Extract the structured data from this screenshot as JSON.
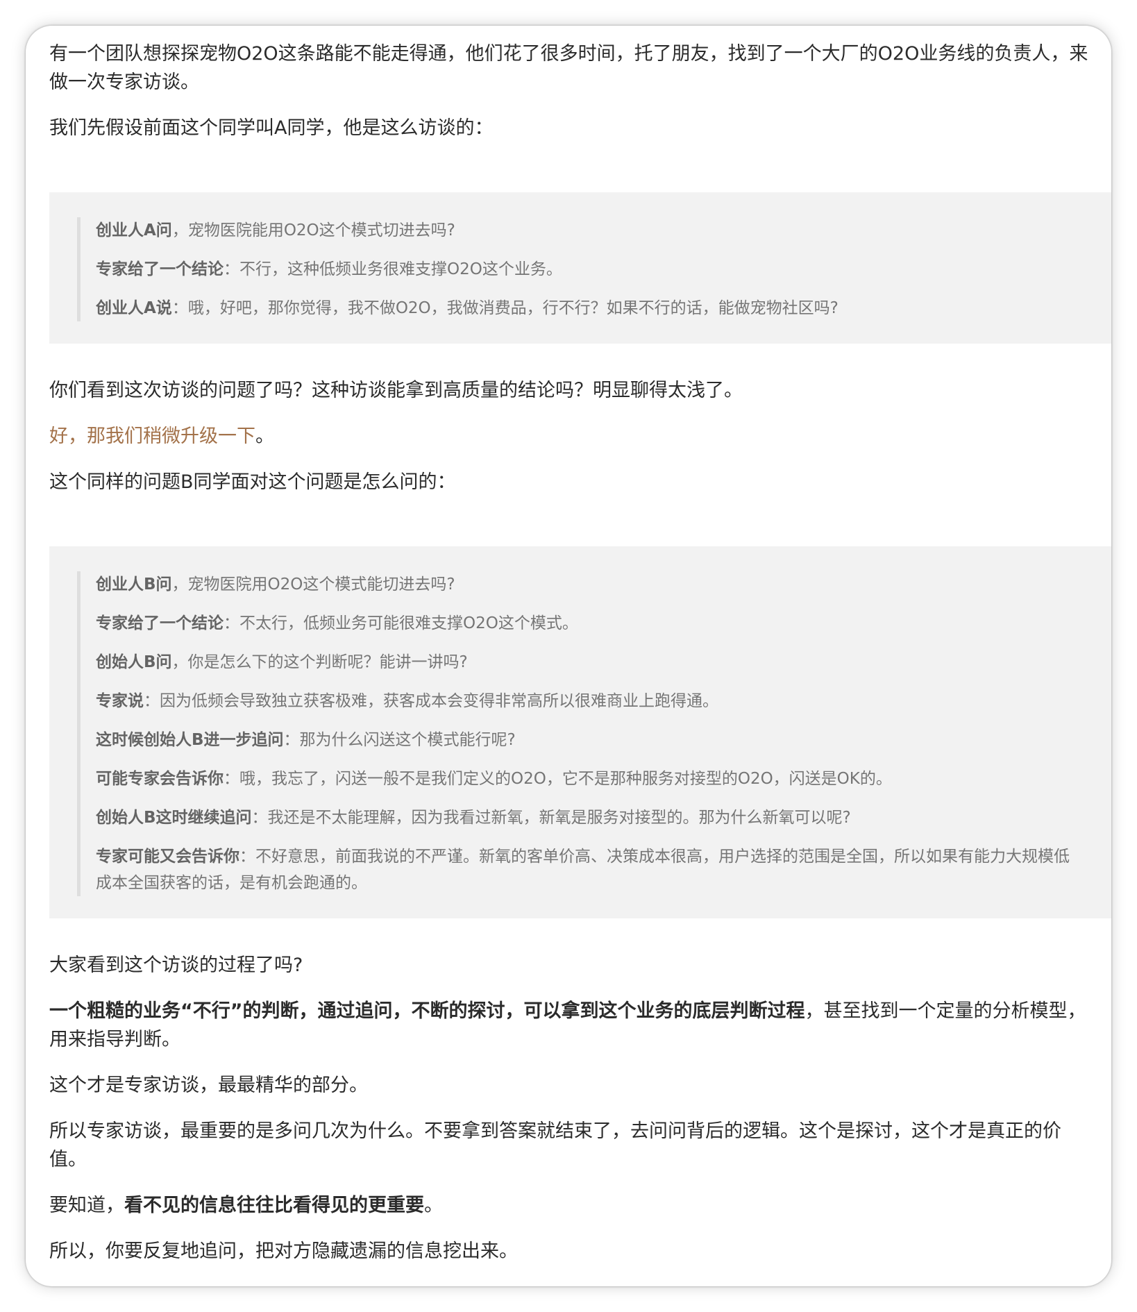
{
  "intro": {
    "p1": "有一个团队想探探宠物O2O这条路能不能走得通，他们花了很多时间，托了朋友，找到了一个大厂的O2O业务线的负责人，来做一次专家访谈。",
    "p2": "我们先假设前面这个同学叫A同学，他是这么访谈的："
  },
  "quote_a": [
    {
      "speaker": "创业人A问",
      "text": "，宠物医院能用O2O这个模式切进去吗?"
    },
    {
      "speaker": "专家给了一个结论",
      "text": "：不行，这种低频业务很难支撑O2O这个业务。"
    },
    {
      "speaker": "创业人A说",
      "text": "：哦，好吧，那你觉得，我不做O2O，我做消费品，行不行？如果不行的话，能做宠物社区吗?"
    }
  ],
  "middle": {
    "p1": "你们看到这次访谈的问题了吗？这种访谈能拿到高质量的结论吗？明显聊得太浅了。",
    "p2_accent": "好，那我们稍微升级一下",
    "p2_end": "。",
    "p3": "这个同样的问题B同学面对这个问题是怎么问的："
  },
  "quote_b": [
    {
      "speaker": "创业人B问",
      "text": "，宠物医院用O2O这个模式能切进去吗?"
    },
    {
      "speaker": "专家给了一个结论",
      "text": "：不太行，低频业务可能很难支撑O2O这个模式。"
    },
    {
      "speaker": "创始人B问",
      "text": "，你是怎么下的这个判断呢？能讲一讲吗?"
    },
    {
      "speaker": "专家说",
      "text": "：因为低频会导致独立获客极难，获客成本会变得非常高所以很难商业上跑得通。"
    },
    {
      "speaker": "这时候创始人B进一步追问",
      "text": "：那为什么闪送这个模式能行呢?"
    },
    {
      "speaker": "可能专家会告诉你",
      "text": "：哦，我忘了，闪送一般不是我们定义的O2O，它不是那种服务对接型的O2O，闪送是OK的。"
    },
    {
      "speaker": "创始人B这时继续追问",
      "text": "：我还是不太能理解，因为我看过新氧，新氧是服务对接型的。那为什么新氧可以呢?"
    },
    {
      "speaker": "专家可能又会告诉你",
      "text": "：不好意思，前面我说的不严谨。新氧的客单价高、决策成本很高，用户选择的范围是全国，所以如果有能力大规模低成本全国获客的话，是有机会跑通的。"
    }
  ],
  "outro": {
    "p1": "大家看到这个访谈的过程了吗?",
    "p2_bold": "一个粗糙的业务“不行”的判断，通过追问，不断的探讨，可以拿到这个业务的底层判断过程",
    "p2_rest": "，甚至找到一个定量的分析模型，用来指导判断。",
    "p3": "这个才是专家访谈，最最精华的部分。",
    "p4": "所以专家访谈，最重要的是多问几次为什么。不要拿到答案就结束了，去问问背后的逻辑。这个是探讨，这个才是真正的价值。",
    "p5_start": "要知道，",
    "p5_bold": "看不见的信息往往比看得见的更重要",
    "p5_end": "。",
    "p6": "所以，你要反复地追问，把对方隐藏遗漏的信息挖出来。"
  }
}
